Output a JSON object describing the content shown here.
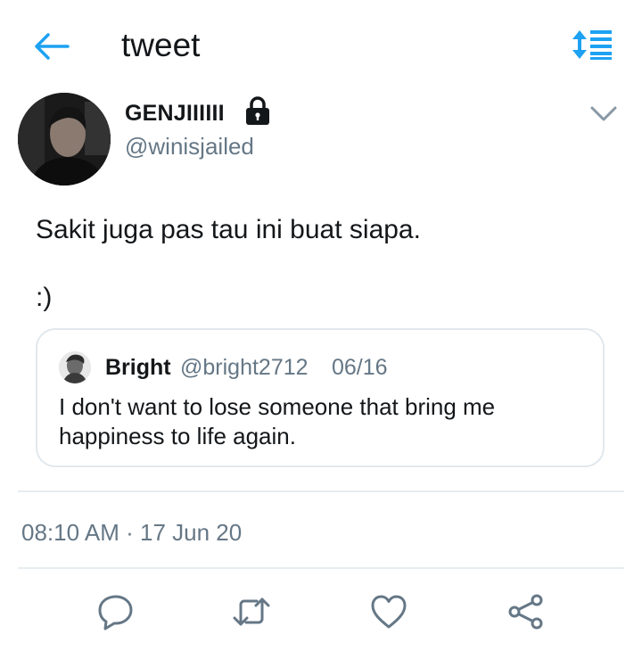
{
  "header": {
    "title": "tweet",
    "back_icon": "arrow-left-icon",
    "sort_icon": "sort-list-icon",
    "accent_color": "#1da1f2"
  },
  "author": {
    "name": "GENJIIIIII",
    "handle": "@winisjailed",
    "protected": true,
    "lock_icon": "lock-icon",
    "menu_icon": "chevron-down-icon"
  },
  "tweet": {
    "text_line1": "Sakit juga pas tau ini buat siapa.",
    "text_line2": ":)"
  },
  "quoted_tweet": {
    "name": "Bright",
    "handle": "@bright2712",
    "date": "06/16",
    "text_line1": "I don't want to lose someone that bring me",
    "text_line2": "happiness to life again."
  },
  "meta": {
    "time": "08:10 AM",
    "separator": "·",
    "date": "17 Jun 20"
  },
  "actions": [
    {
      "name": "reply",
      "icon": "reply-icon"
    },
    {
      "name": "retweet",
      "icon": "retweet-icon"
    },
    {
      "name": "like",
      "icon": "heart-icon"
    },
    {
      "name": "share",
      "icon": "share-icon"
    }
  ],
  "colors": {
    "primary_text": "#14171a",
    "secondary_text": "#657786",
    "border": "#e1e8ed",
    "icon_gray": "#657786"
  }
}
